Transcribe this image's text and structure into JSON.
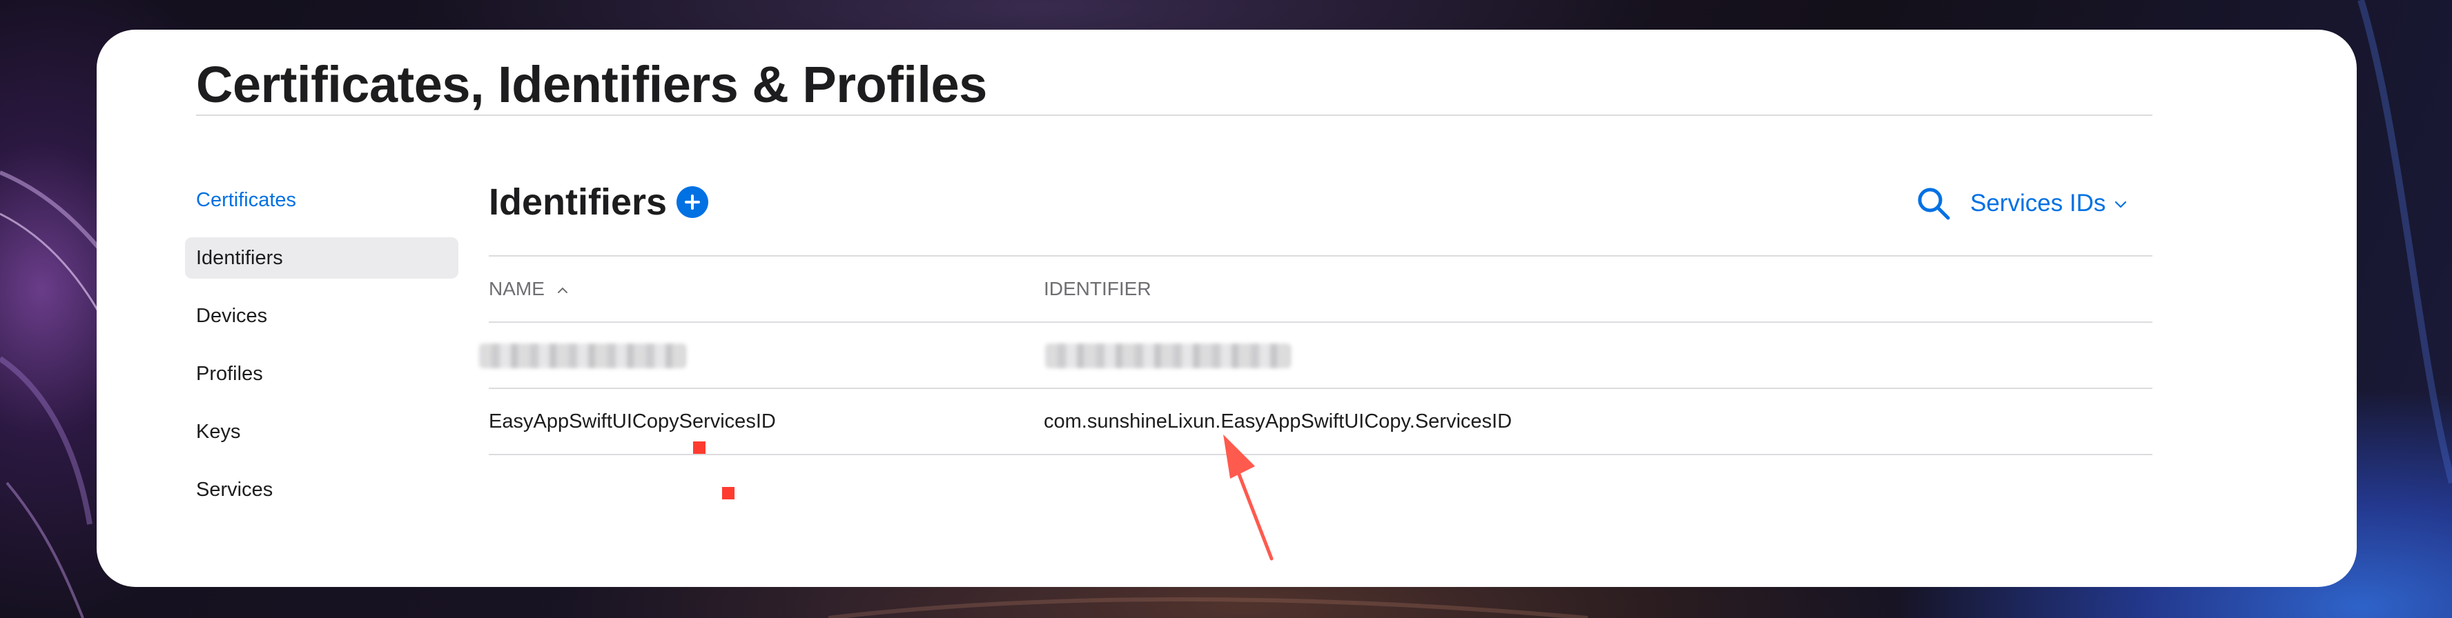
{
  "page": {
    "title": "Certificates, Identifiers & Profiles"
  },
  "sidebar": {
    "items": [
      {
        "label": "Certificates",
        "state": "link"
      },
      {
        "label": "Identifiers",
        "state": "active"
      },
      {
        "label": "Devices",
        "state": "normal"
      },
      {
        "label": "Profiles",
        "state": "normal"
      },
      {
        "label": "Keys",
        "state": "normal"
      },
      {
        "label": "Services",
        "state": "normal"
      }
    ]
  },
  "main": {
    "heading": "Identifiers",
    "add_icon": "plus-circle-icon",
    "search_icon": "search-icon",
    "filter": {
      "selected": "Services IDs",
      "icon": "chevron-down-icon"
    },
    "table": {
      "columns": [
        {
          "label": "NAME",
          "sort_icon": "caret-up-icon"
        },
        {
          "label": "IDENTIFIER"
        }
      ],
      "rows": [
        {
          "name": "",
          "identifier": "",
          "redacted": true
        },
        {
          "name": "EasyAppSwiftUICopyServicesID",
          "identifier": "com.sunshineLixun.EasyAppSwiftUICopy.ServicesID",
          "redacted": false
        }
      ]
    }
  },
  "annotation": {
    "arrow_color": "#ff5a4e",
    "marker_color": "#ff3b30"
  },
  "colors": {
    "accent": "#0071e3",
    "text": "#1d1d1f",
    "muted": "#6e6e73",
    "active_bg": "#ebebed",
    "divider": "#dcdcdf"
  }
}
